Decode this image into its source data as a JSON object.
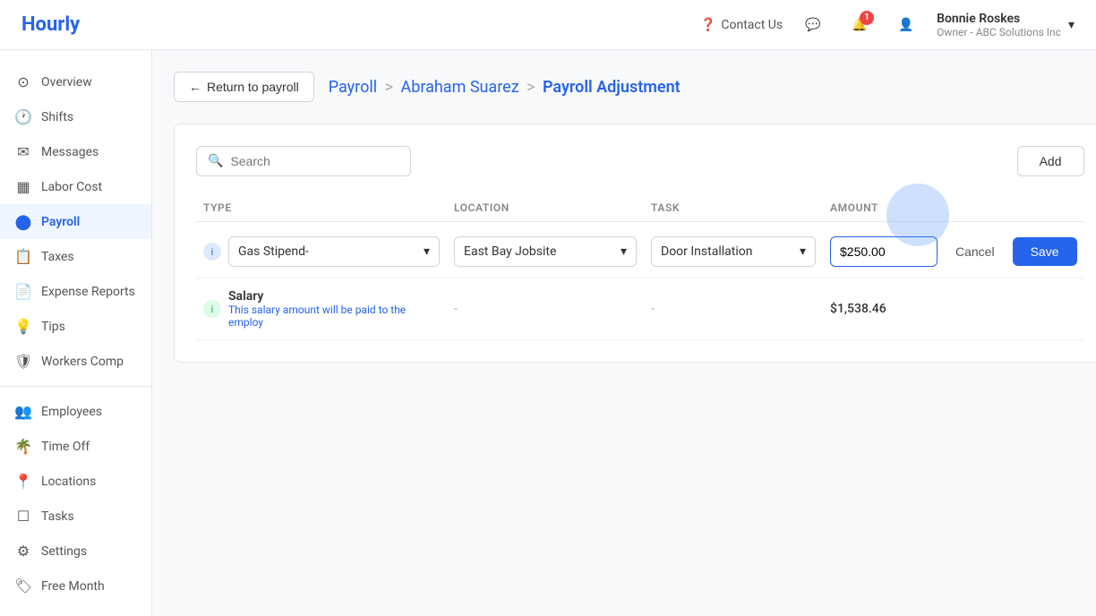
{
  "app": {
    "logo": "Hourly"
  },
  "topnav": {
    "contact_label": "Contact Us",
    "notification_count": "1",
    "user_name": "Bonnie Roskes",
    "user_company": "Owner - ABC Solutions Inc",
    "chevron": "▾"
  },
  "sidebar": {
    "items": [
      {
        "id": "overview",
        "label": "Overview",
        "icon": "⊙"
      },
      {
        "id": "shifts",
        "label": "Shifts",
        "icon": "○"
      },
      {
        "id": "messages",
        "label": "Messages",
        "icon": "✉"
      },
      {
        "id": "labor-cost",
        "label": "Labor Cost",
        "icon": "▦"
      },
      {
        "id": "payroll",
        "label": "Payroll",
        "icon": "⬤",
        "active": true
      },
      {
        "id": "taxes",
        "label": "Taxes",
        "icon": "○"
      },
      {
        "id": "expense-reports",
        "label": "Expense Reports",
        "icon": "☐"
      },
      {
        "id": "tips",
        "label": "Tips",
        "icon": "○"
      },
      {
        "id": "workers-comp",
        "label": "Workers Comp",
        "icon": "○"
      },
      {
        "id": "employees",
        "label": "Employees",
        "icon": "○"
      },
      {
        "id": "time-off",
        "label": "Time Off",
        "icon": "○"
      },
      {
        "id": "locations",
        "label": "Locations",
        "icon": "◎"
      },
      {
        "id": "tasks",
        "label": "Tasks",
        "icon": "☐"
      },
      {
        "id": "settings",
        "label": "Settings",
        "icon": "⚙"
      },
      {
        "id": "free-month",
        "label": "Free Month",
        "icon": "○"
      }
    ]
  },
  "page": {
    "back_label": "Return to payroll",
    "breadcrumb": {
      "part1": "Payroll",
      "sep1": ">",
      "part2": "Abraham Suarez",
      "sep2": ">",
      "part3": "Payroll Adjustment"
    },
    "search_placeholder": "Search",
    "add_label": "Add"
  },
  "table": {
    "headers": [
      "TYPE",
      "LOCATION",
      "TASK",
      "AMOUNT"
    ],
    "row1": {
      "icon_type": "info",
      "type_value": "Gas Stipend-",
      "location_value": "East Bay Jobsite",
      "task_value": "Door Installation",
      "amount_value": "$250.00",
      "cancel_label": "Cancel",
      "save_label": "Save"
    },
    "row2": {
      "icon_type": "info",
      "label": "Salary",
      "description": "This salary amount will be paid to the employ",
      "location": "-",
      "task": "-",
      "amount": "$1,538.46"
    }
  }
}
